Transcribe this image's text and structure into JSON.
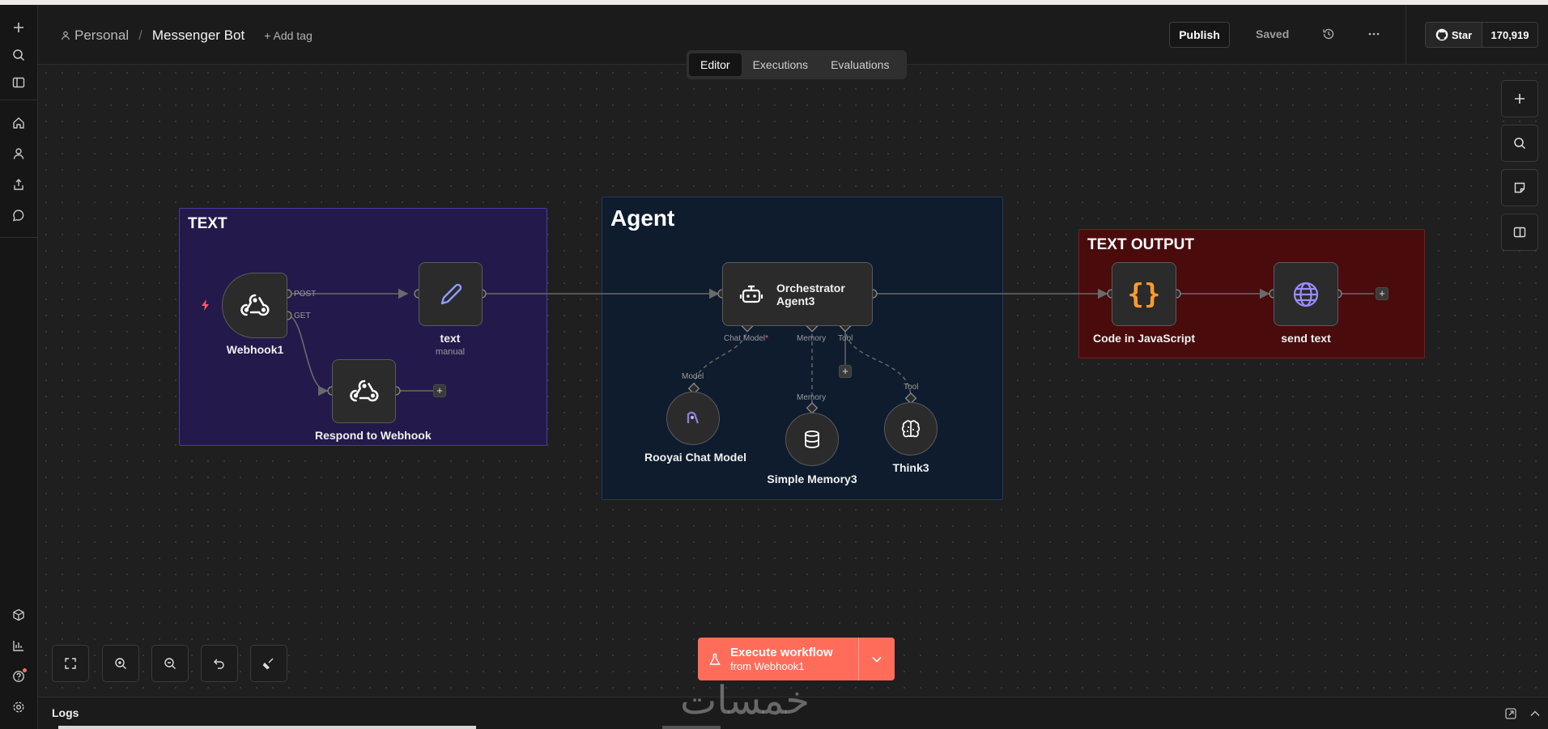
{
  "header": {
    "breadcrumb_project": "Personal",
    "workflow_name": "Messenger Bot",
    "add_tag": "+ Add tag",
    "publish_label": "Publish",
    "saved_label": "Saved",
    "github_star_label": "Star",
    "github_star_count": "170,919"
  },
  "tabs": [
    {
      "label": "Editor",
      "active": true
    },
    {
      "label": "Executions",
      "active": false
    },
    {
      "label": "Evaluations",
      "active": false
    }
  ],
  "canvas": {
    "groups": {
      "text": "TEXT",
      "agent": "Agent",
      "output": "TEXT OUTPUT"
    },
    "nodes": {
      "webhook": {
        "label": "Webhook1",
        "out_post": "POST",
        "out_get": "GET"
      },
      "text": {
        "label": "text",
        "sub": "manual"
      },
      "respond": {
        "label": "Respond to Webhook"
      },
      "agent": {
        "label_line1": "Orchestrator",
        "label_line2": "Agent3",
        "port_chat": "Chat Model",
        "port_memory": "Memory",
        "port_tool": "Tool"
      },
      "rooyai": {
        "label": "Rooyai Chat Model",
        "port": "Model"
      },
      "memory": {
        "label": "Simple Memory3",
        "port": "Memory"
      },
      "think": {
        "label": "Think3",
        "port": "Tool"
      },
      "code": {
        "label": "Code in JavaScript"
      },
      "send": {
        "label": "send text"
      }
    }
  },
  "execute": {
    "label": "Execute workflow",
    "sub": "from Webhook1"
  },
  "logs": {
    "title": "Logs"
  },
  "colors": {
    "accent": "#ff6d5a",
    "group_text": "#231a4b",
    "group_agent": "#0e1c2e",
    "group_output": "#4a0b0d"
  }
}
